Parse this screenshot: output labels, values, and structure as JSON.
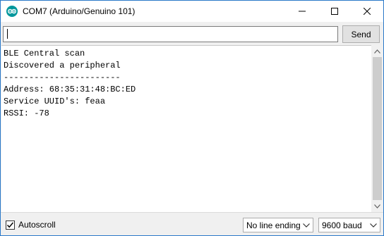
{
  "window": {
    "title": "COM7 (Arduino/Genuino 101)",
    "app_icon": "arduino-icon",
    "controls": [
      "minimize-icon",
      "maximize-icon",
      "close-icon"
    ]
  },
  "input_bar": {
    "input_value": "",
    "send_label": "Send"
  },
  "output": {
    "lines": [
      "BLE Central scan",
      "Discovered a peripheral",
      "-----------------------",
      "Address: 68:35:31:48:BC:ED",
      "Service UUID's: feaa",
      "RSSI: -78"
    ]
  },
  "statusbar": {
    "autoscroll_label": "Autoscroll",
    "autoscroll_checked": true,
    "line_ending": "No line ending",
    "baud_rate": "9600 baud"
  },
  "colors": {
    "accent_border": "#2b79c9",
    "arduino_teal": "#00979c"
  }
}
